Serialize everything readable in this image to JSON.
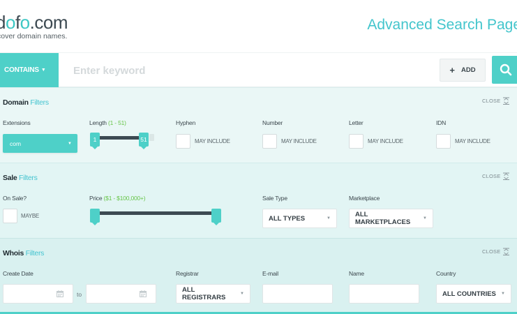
{
  "header": {
    "logo_prefix": "d",
    "logo_o": "o",
    "logo_f": "f",
    "logo_o2": "o",
    "logo_suffix": ".com",
    "tagline": "cover domain names.",
    "page_title": "Advanced Search Page"
  },
  "search": {
    "contains_label": "CONTAINS",
    "keyword_placeholder": "Enter keyword",
    "keyword_value": "",
    "add_label": "ADD"
  },
  "domain_filters": {
    "title": "Domain",
    "title_accent": "Filters",
    "close_label": "CLOSE",
    "extensions_label": "Extensions",
    "extensions_value": "com",
    "length_label": "Length",
    "length_range": "(1 - 51)",
    "length_min": "1",
    "length_max": "51",
    "hyphen_label": "Hyphen",
    "number_label": "Number",
    "letter_label": "Letter",
    "idn_label": "IDN",
    "may_include": "MAY INCLUDE"
  },
  "sale_filters": {
    "title": "Sale",
    "title_accent": "Filters",
    "close_label": "CLOSE",
    "on_sale_label": "On Sale?",
    "on_sale_option": "MAYBE",
    "price_label": "Price",
    "price_range": "($1 - $100,000+)",
    "sale_type_label": "Sale Type",
    "sale_type_value": "ALL TYPES",
    "marketplace_label": "Marketplace",
    "marketplace_value": "ALL MARKETPLACES"
  },
  "whois_filters": {
    "title": "Whois",
    "title_accent": "Filters",
    "close_label": "CLOSE",
    "create_date_label": "Create Date",
    "to_label": "to",
    "registrar_label": "Registrar",
    "registrar_value": "ALL REGISTRARS",
    "email_label": "E-mail",
    "name_label": "Name",
    "country_label": "Country",
    "country_value": "ALL COUNTRIES"
  },
  "icons": {
    "search": "search-icon",
    "plus": "plus-icon",
    "close": "collapse-icon",
    "calendar": "calendar-icon",
    "caret": "chevron-down-icon"
  },
  "colors": {
    "accent": "#4ed0c8",
    "title_blue": "#43c5cc",
    "range_green": "#68c54a",
    "slider_track": "#3c4a52"
  }
}
